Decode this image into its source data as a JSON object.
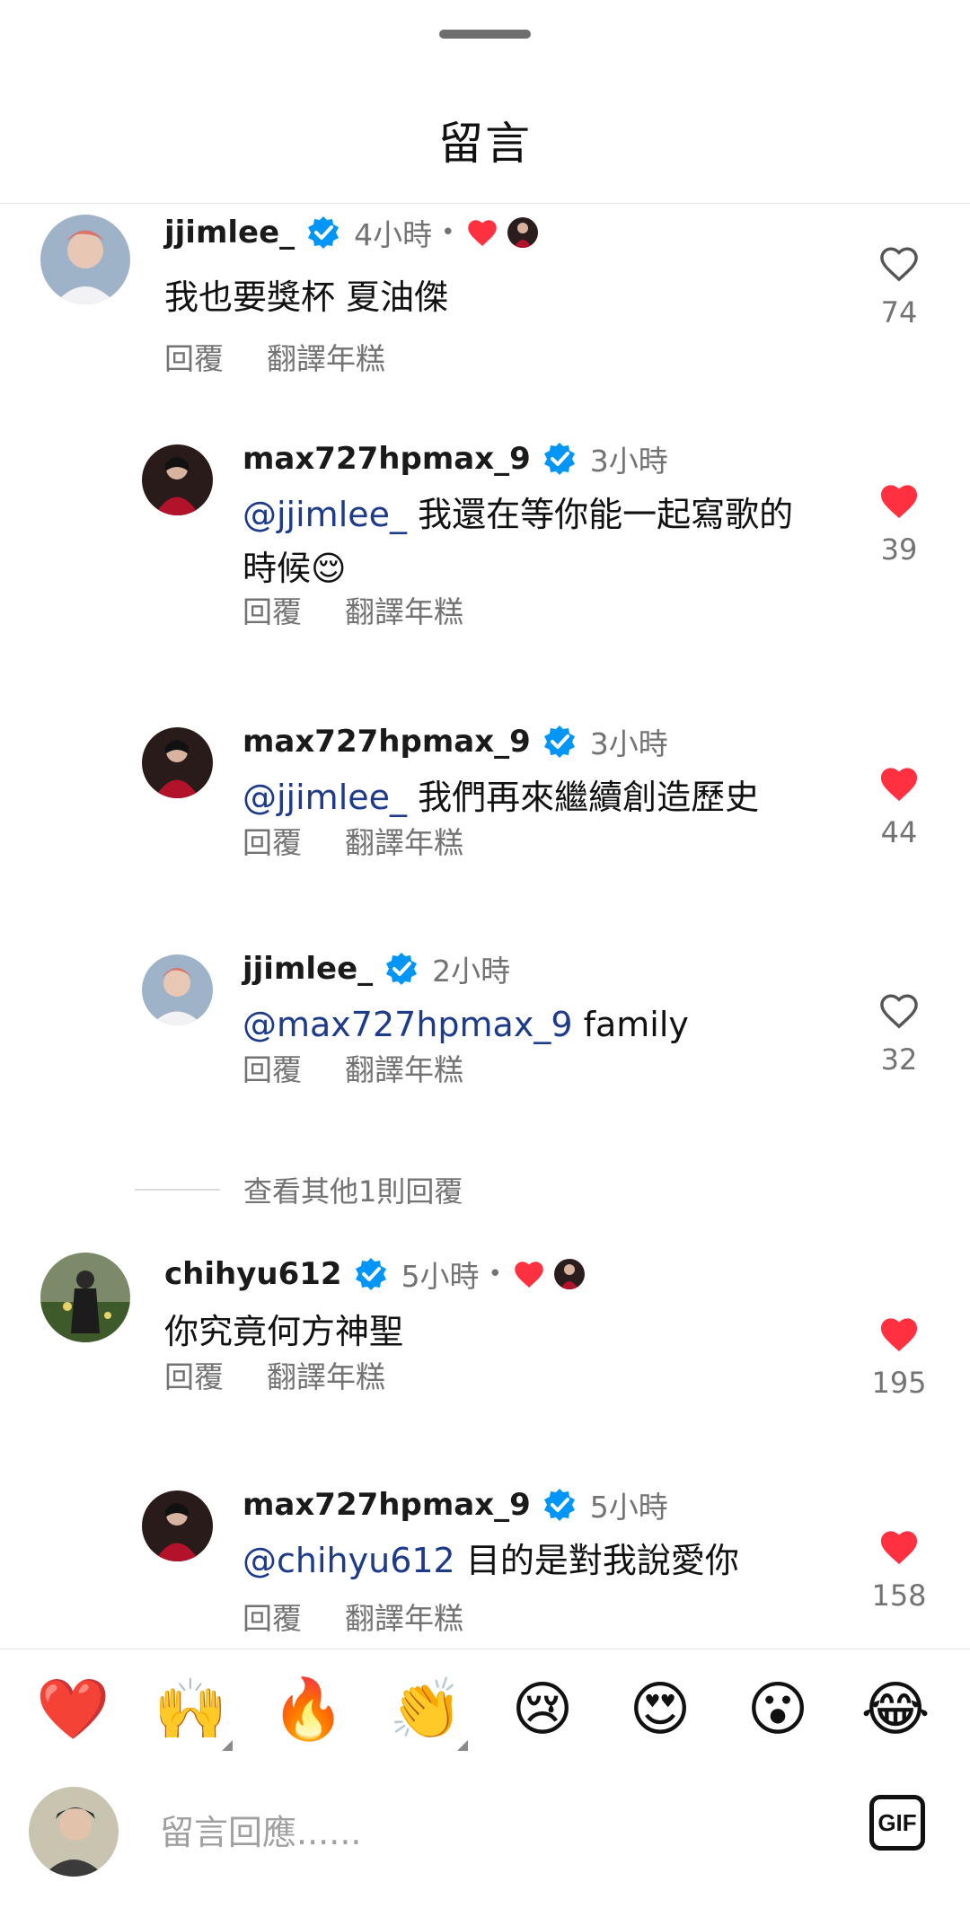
{
  "header": {
    "title": "留言"
  },
  "comments": [
    {
      "user": "jjimlee_",
      "time": "4小時",
      "author_liked": true,
      "text": "我也要獎杯 夏油傑",
      "reply_label": "回覆",
      "translate_label": "翻譯年糕",
      "likes": "74",
      "liked": false
    },
    {
      "user": "max727hpmax_9",
      "time": "3小時",
      "mention": "@jjimlee_",
      "text": " 我還在等你能一起寫歌的時候😌",
      "reply_label": "回覆",
      "translate_label": "翻譯年糕",
      "likes": "39",
      "liked": true
    },
    {
      "user": "max727hpmax_9",
      "time": "3小時",
      "mention": "@jjimlee_",
      "text": " 我們再來繼續創造歷史",
      "reply_label": "回覆",
      "translate_label": "翻譯年糕",
      "likes": "44",
      "liked": true
    },
    {
      "user": "jjimlee_",
      "time": "2小時",
      "mention": "@max727hpmax_9",
      "text": " family",
      "reply_label": "回覆",
      "translate_label": "翻譯年糕",
      "likes": "32",
      "liked": false
    },
    {
      "user": "chihyu612",
      "time": "5小時",
      "author_liked": true,
      "text": "你究竟何方神聖",
      "reply_label": "回覆",
      "translate_label": "翻譯年糕",
      "likes": "195",
      "liked": true
    },
    {
      "user": "max727hpmax_9",
      "time": "5小時",
      "mention": "@chihyu612",
      "text": " 目的是對我說愛你",
      "reply_label": "回覆",
      "translate_label": "翻譯年糕",
      "likes": "158",
      "liked": true
    }
  ],
  "view_more_replies": "查看其他1則回覆",
  "emoji_bar": [
    "❤️",
    "🙌",
    "🔥",
    "👏",
    "😢",
    "😍",
    "😮",
    "😂"
  ],
  "composer": {
    "placeholder": "留言回應......",
    "gif_label": "GIF"
  },
  "colors": {
    "heart_red": "#ff3040",
    "verified_blue": "#0095f6",
    "mention": "#1e3a8a",
    "muted": "#737373"
  }
}
